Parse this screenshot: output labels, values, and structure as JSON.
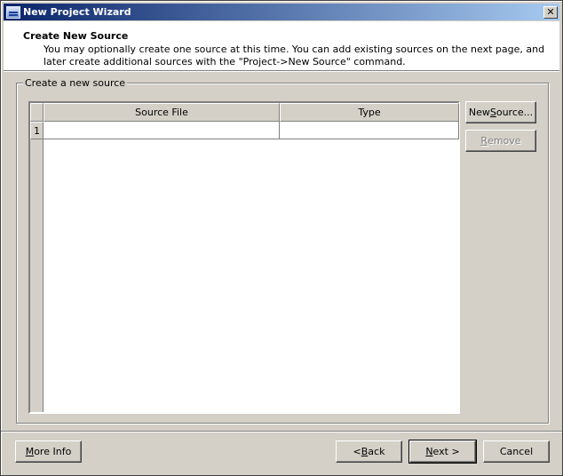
{
  "window": {
    "title": "New Project Wizard",
    "close_glyph": "✕"
  },
  "header": {
    "title": "Create New Source",
    "description": "You may optionally create one source at this time. You can add existing sources on the next page, and later create additional sources with the \"Project->New Source\" command."
  },
  "group": {
    "label": "Create a new source"
  },
  "table": {
    "columns": [
      "Source File",
      "Type"
    ],
    "rows": [
      {
        "number": "1",
        "source_file": "",
        "type": ""
      }
    ]
  },
  "side_buttons": {
    "new_source": {
      "pre": "New ",
      "mnemonic": "S",
      "post": "ource..."
    },
    "remove": {
      "pre": "",
      "mnemonic": "R",
      "post": "emove"
    }
  },
  "footer": {
    "more_info": {
      "pre": "",
      "mnemonic": "M",
      "post": "ore Info"
    },
    "back": {
      "pre": "< ",
      "mnemonic": "B",
      "post": "ack"
    },
    "next": {
      "pre": "",
      "mnemonic": "N",
      "post": "ext >"
    },
    "cancel": "Cancel"
  }
}
